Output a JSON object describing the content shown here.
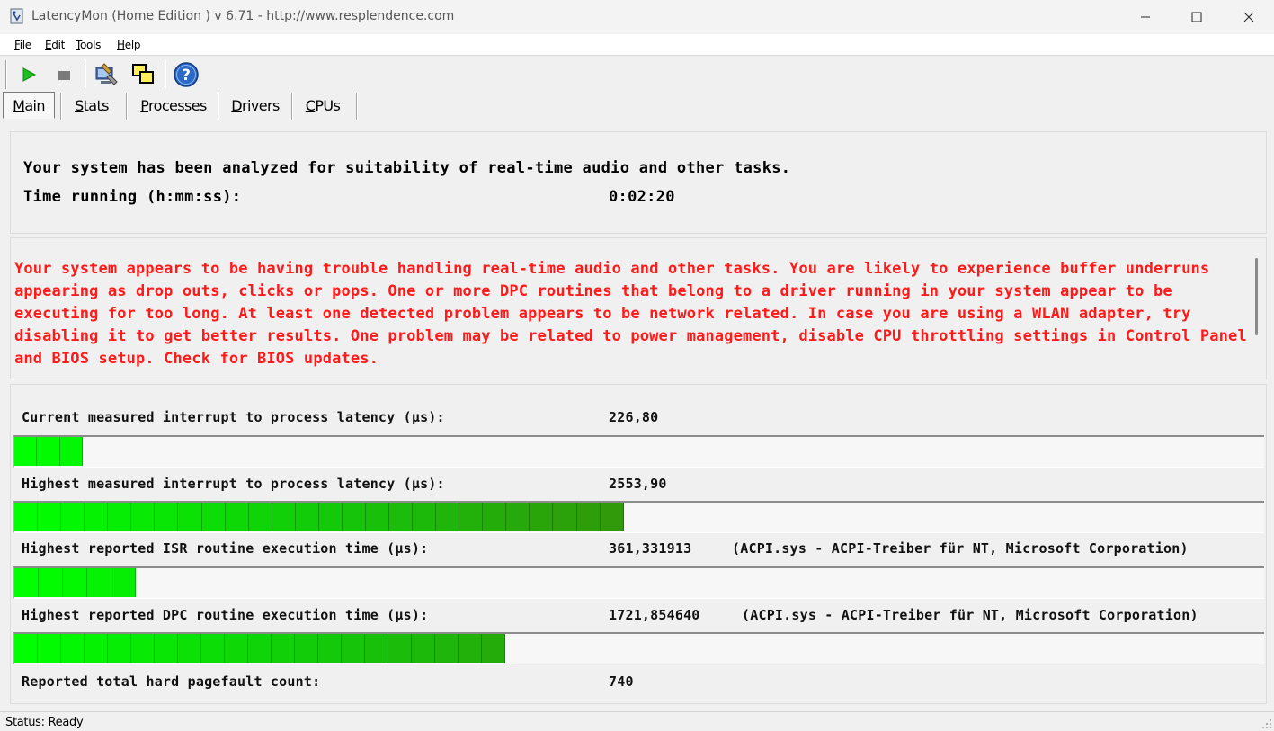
{
  "window": {
    "title": "LatencyMon  (Home Edition )  v 6.71 - http://www.resplendence.com",
    "minimize_icon": "minimize-icon",
    "maximize_icon": "maximize-icon",
    "close_icon": "close-icon"
  },
  "menu": {
    "items": [
      "File",
      "Edit",
      "Tools",
      "Help"
    ]
  },
  "toolbar": {
    "buttons": [
      {
        "icon": "play-icon",
        "color": "#1fbf1f"
      },
      {
        "icon": "stop-icon",
        "color": "#7a7a7a"
      },
      {
        "icon": "monitor-settings-icon"
      },
      {
        "icon": "windows-overlay-icon"
      },
      {
        "icon": "help-icon",
        "color": "#2060c0"
      }
    ]
  },
  "tabs": {
    "items": [
      "Main",
      "Stats",
      "Processes",
      "Drivers",
      "CPUs"
    ],
    "active": "Main"
  },
  "summary": {
    "analyzed_text": "Your system has been analyzed for suitability of real-time audio and other tasks.",
    "time_label": "Time running (h:mm:ss):",
    "time_value": "0:02:20"
  },
  "message": {
    "text": "Your system appears to be having trouble handling real-time audio and other tasks. You are likely to experience buffer underruns appearing as drop outs, clicks or pops. One or more DPC routines that belong to a driver running in your system appear to be executing for too long. At least one detected problem appears to be network related. In case you are using a WLAN adapter, try disabling it to get better results. One problem may be related to power management, disable CPU throttling settings in Control Panel and BIOS setup. Check for BIOS updates.",
    "color": "#ff1a1a"
  },
  "metrics": {
    "current_label": "Current measured interrupt to process latency (µs):",
    "current_value": "226,80",
    "current_level": 0.055,
    "highest_label": "Highest measured interrupt to process latency (µs):",
    "highest_value": "2553,90",
    "highest_level": 0.488,
    "isr_label": "Highest reported ISR routine execution time (µs):",
    "isr_value": "361,331913",
    "isr_driver": "(ACPI.sys - ACPI-Treiber für NT, Microsoft Corporation)",
    "isr_level": 0.097,
    "dpc_label": "Highest reported DPC routine execution time (µs):",
    "dpc_value": "1721,854640",
    "dpc_driver": "(ACPI.sys - ACPI-Treiber für NT, Microsoft Corporation)",
    "dpc_level": 0.393,
    "pagefault_label": "Reported total hard pagefault count:",
    "pagefault_value": "740"
  },
  "status": {
    "text": "Status: Ready"
  }
}
